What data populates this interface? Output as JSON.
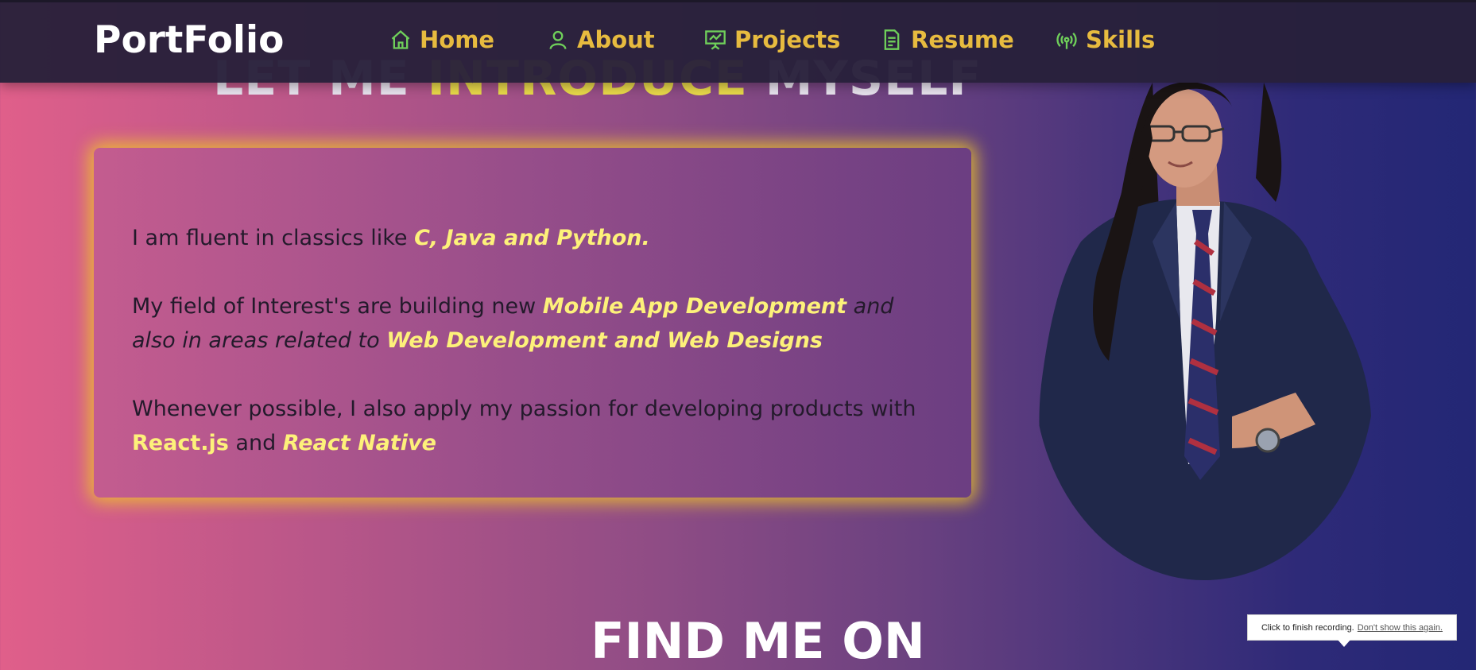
{
  "navbar": {
    "brand": "PortFolio",
    "items": [
      {
        "label": "Home",
        "icon": "home-icon"
      },
      {
        "label": "About",
        "icon": "user-icon"
      },
      {
        "label": "Projects",
        "icon": "presentation-icon"
      },
      {
        "label": "Resume",
        "icon": "document-icon"
      },
      {
        "label": "Skills",
        "icon": "broadcast-icon"
      }
    ]
  },
  "intro": {
    "title_part1": "LET ME ",
    "title_accent": "INTRODUCE",
    "title_part2": " MYSELF",
    "p1_text": "I am fluent in classics like ",
    "p1_highlight": "C, Java and Python.",
    "p2_text": "My field of Interest's are building new  ",
    "p2_highlight1": "Mobile App Development",
    "p2_italic": " and also in areas related to ",
    "p2_highlight2": "Web Development and Web Designs",
    "p3_text": "Whenever possible, I also apply my passion for developing products with ",
    "p3_highlight1": "React.js",
    "p3_and": " and ",
    "p3_highlight2": "React Native"
  },
  "find": {
    "title": "FIND ME ON"
  },
  "tooltip": {
    "text": "Click to finish recording.",
    "link": "Don't show this again."
  },
  "colors": {
    "accent_yellow": "#e9d94a",
    "nav_text": "#e7bb3f",
    "nav_icon": "#6fcf5a",
    "highlight": "#fdf17a"
  }
}
